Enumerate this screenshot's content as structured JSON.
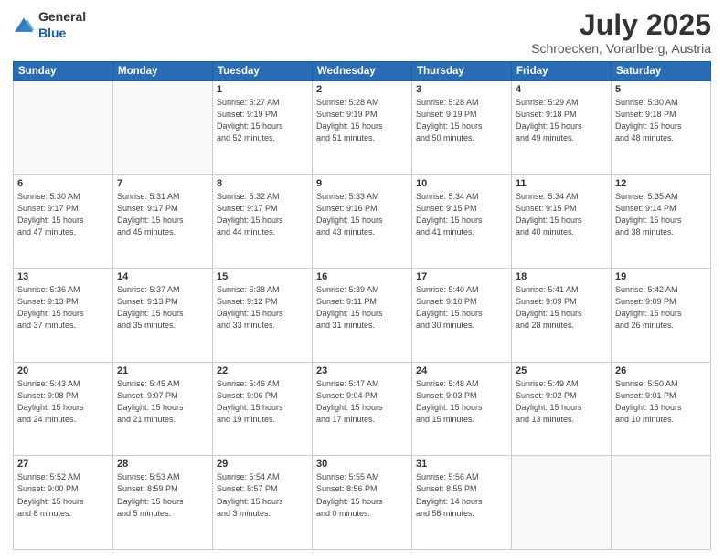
{
  "header": {
    "logo_general": "General",
    "logo_blue": "Blue",
    "title": "July 2025",
    "subtitle": "Schroecken, Vorarlberg, Austria"
  },
  "weekdays": [
    "Sunday",
    "Monday",
    "Tuesday",
    "Wednesday",
    "Thursday",
    "Friday",
    "Saturday"
  ],
  "weeks": [
    [
      {
        "day": "",
        "info": ""
      },
      {
        "day": "",
        "info": ""
      },
      {
        "day": "1",
        "info": "Sunrise: 5:27 AM\nSunset: 9:19 PM\nDaylight: 15 hours\nand 52 minutes."
      },
      {
        "day": "2",
        "info": "Sunrise: 5:28 AM\nSunset: 9:19 PM\nDaylight: 15 hours\nand 51 minutes."
      },
      {
        "day": "3",
        "info": "Sunrise: 5:28 AM\nSunset: 9:19 PM\nDaylight: 15 hours\nand 50 minutes."
      },
      {
        "day": "4",
        "info": "Sunrise: 5:29 AM\nSunset: 9:18 PM\nDaylight: 15 hours\nand 49 minutes."
      },
      {
        "day": "5",
        "info": "Sunrise: 5:30 AM\nSunset: 9:18 PM\nDaylight: 15 hours\nand 48 minutes."
      }
    ],
    [
      {
        "day": "6",
        "info": "Sunrise: 5:30 AM\nSunset: 9:17 PM\nDaylight: 15 hours\nand 47 minutes."
      },
      {
        "day": "7",
        "info": "Sunrise: 5:31 AM\nSunset: 9:17 PM\nDaylight: 15 hours\nand 45 minutes."
      },
      {
        "day": "8",
        "info": "Sunrise: 5:32 AM\nSunset: 9:17 PM\nDaylight: 15 hours\nand 44 minutes."
      },
      {
        "day": "9",
        "info": "Sunrise: 5:33 AM\nSunset: 9:16 PM\nDaylight: 15 hours\nand 43 minutes."
      },
      {
        "day": "10",
        "info": "Sunrise: 5:34 AM\nSunset: 9:15 PM\nDaylight: 15 hours\nand 41 minutes."
      },
      {
        "day": "11",
        "info": "Sunrise: 5:34 AM\nSunset: 9:15 PM\nDaylight: 15 hours\nand 40 minutes."
      },
      {
        "day": "12",
        "info": "Sunrise: 5:35 AM\nSunset: 9:14 PM\nDaylight: 15 hours\nand 38 minutes."
      }
    ],
    [
      {
        "day": "13",
        "info": "Sunrise: 5:36 AM\nSunset: 9:13 PM\nDaylight: 15 hours\nand 37 minutes."
      },
      {
        "day": "14",
        "info": "Sunrise: 5:37 AM\nSunset: 9:13 PM\nDaylight: 15 hours\nand 35 minutes."
      },
      {
        "day": "15",
        "info": "Sunrise: 5:38 AM\nSunset: 9:12 PM\nDaylight: 15 hours\nand 33 minutes."
      },
      {
        "day": "16",
        "info": "Sunrise: 5:39 AM\nSunset: 9:11 PM\nDaylight: 15 hours\nand 31 minutes."
      },
      {
        "day": "17",
        "info": "Sunrise: 5:40 AM\nSunset: 9:10 PM\nDaylight: 15 hours\nand 30 minutes."
      },
      {
        "day": "18",
        "info": "Sunrise: 5:41 AM\nSunset: 9:09 PM\nDaylight: 15 hours\nand 28 minutes."
      },
      {
        "day": "19",
        "info": "Sunrise: 5:42 AM\nSunset: 9:09 PM\nDaylight: 15 hours\nand 26 minutes."
      }
    ],
    [
      {
        "day": "20",
        "info": "Sunrise: 5:43 AM\nSunset: 9:08 PM\nDaylight: 15 hours\nand 24 minutes."
      },
      {
        "day": "21",
        "info": "Sunrise: 5:45 AM\nSunset: 9:07 PM\nDaylight: 15 hours\nand 21 minutes."
      },
      {
        "day": "22",
        "info": "Sunrise: 5:46 AM\nSunset: 9:06 PM\nDaylight: 15 hours\nand 19 minutes."
      },
      {
        "day": "23",
        "info": "Sunrise: 5:47 AM\nSunset: 9:04 PM\nDaylight: 15 hours\nand 17 minutes."
      },
      {
        "day": "24",
        "info": "Sunrise: 5:48 AM\nSunset: 9:03 PM\nDaylight: 15 hours\nand 15 minutes."
      },
      {
        "day": "25",
        "info": "Sunrise: 5:49 AM\nSunset: 9:02 PM\nDaylight: 15 hours\nand 13 minutes."
      },
      {
        "day": "26",
        "info": "Sunrise: 5:50 AM\nSunset: 9:01 PM\nDaylight: 15 hours\nand 10 minutes."
      }
    ],
    [
      {
        "day": "27",
        "info": "Sunrise: 5:52 AM\nSunset: 9:00 PM\nDaylight: 15 hours\nand 8 minutes."
      },
      {
        "day": "28",
        "info": "Sunrise: 5:53 AM\nSunset: 8:59 PM\nDaylight: 15 hours\nand 5 minutes."
      },
      {
        "day": "29",
        "info": "Sunrise: 5:54 AM\nSunset: 8:57 PM\nDaylight: 15 hours\nand 3 minutes."
      },
      {
        "day": "30",
        "info": "Sunrise: 5:55 AM\nSunset: 8:56 PM\nDaylight: 15 hours\nand 0 minutes."
      },
      {
        "day": "31",
        "info": "Sunrise: 5:56 AM\nSunset: 8:55 PM\nDaylight: 14 hours\nand 58 minutes."
      },
      {
        "day": "",
        "info": ""
      },
      {
        "day": "",
        "info": ""
      }
    ]
  ]
}
